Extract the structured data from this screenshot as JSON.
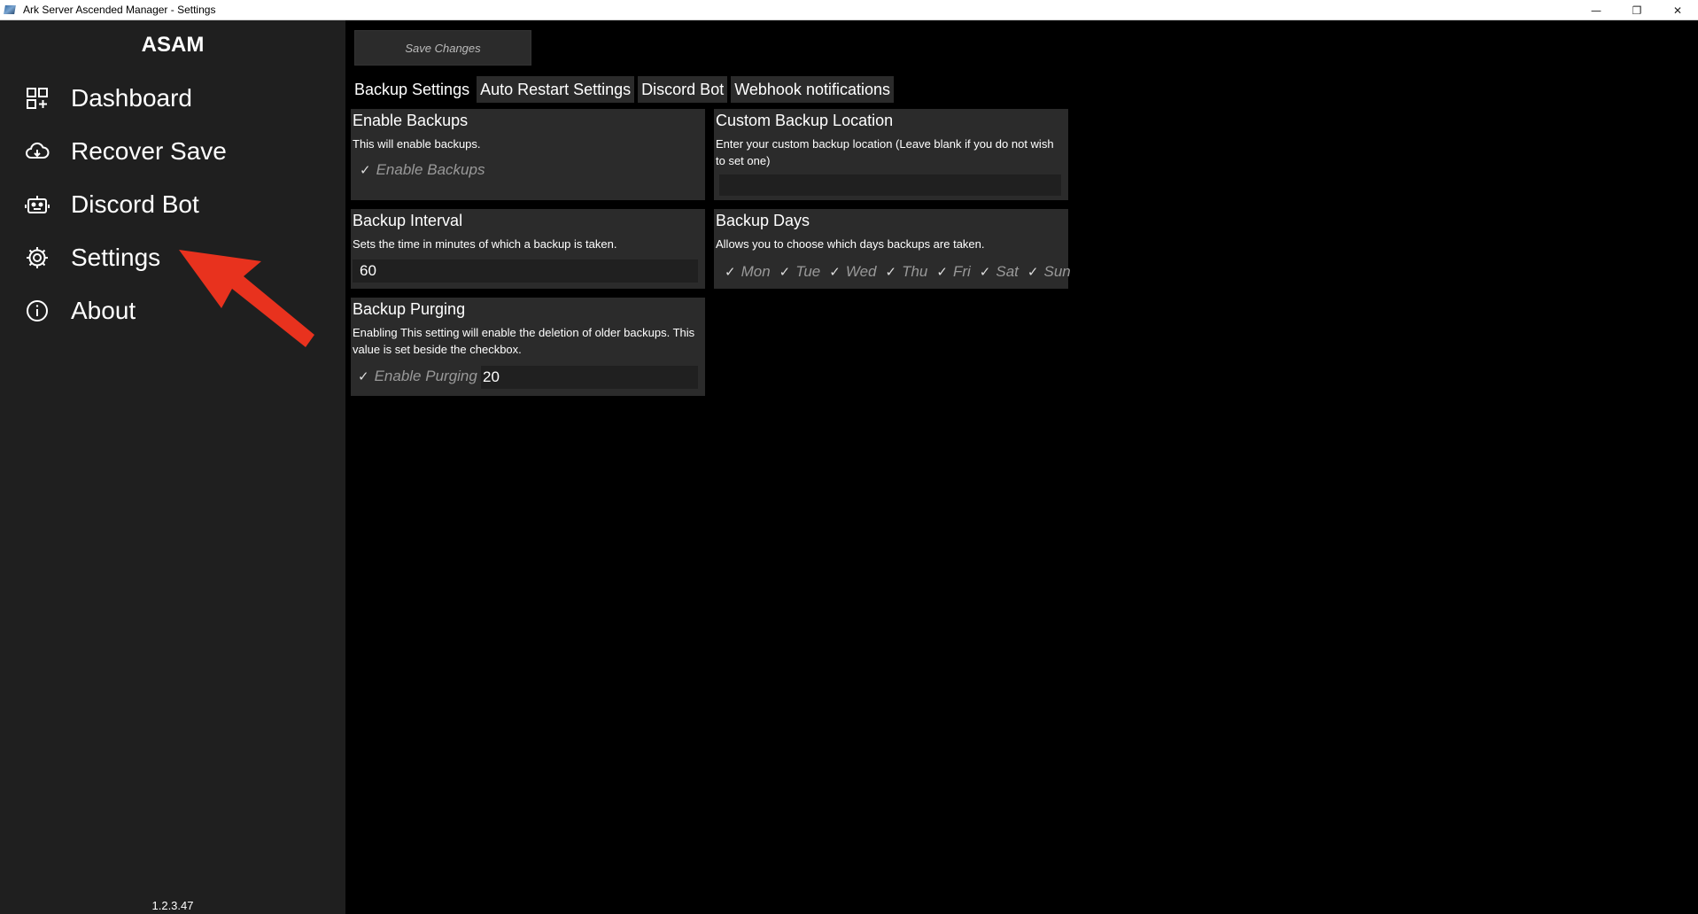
{
  "window": {
    "title": "Ark Server Ascended Manager - Settings",
    "minimize": "—",
    "restore": "❐",
    "close": "✕"
  },
  "sidebar": {
    "brand": "ASAM",
    "items": [
      {
        "label": "Dashboard",
        "icon": "dashboard-icon"
      },
      {
        "label": "Recover Save",
        "icon": "cloud-download-icon"
      },
      {
        "label": "Discord Bot",
        "icon": "bot-icon"
      },
      {
        "label": "Settings",
        "icon": "gear-icon"
      },
      {
        "label": "About",
        "icon": "info-icon"
      }
    ],
    "version": "1.2.3.47"
  },
  "toolbar": {
    "save_label": "Save Changes"
  },
  "tabs": [
    {
      "label": "Backup Settings",
      "active": true
    },
    {
      "label": "Auto Restart Settings",
      "active": false
    },
    {
      "label": "Discord Bot",
      "active": false
    },
    {
      "label": "Webhook notifications",
      "active": false
    }
  ],
  "cards": {
    "enable_backups": {
      "title": "Enable Backups",
      "desc": "This will enable backups.",
      "check_label": "Enable Backups",
      "checked": true
    },
    "custom_location": {
      "title": "Custom Backup Location",
      "desc": "Enter your custom backup location (Leave blank if you do not wish to set one)",
      "value": ""
    },
    "interval": {
      "title": "Backup Interval",
      "desc": "Sets the time in minutes of which a backup is taken.",
      "value": "60"
    },
    "days": {
      "title": "Backup Days",
      "desc": "Allows you to choose which days backups are taken.",
      "days": [
        "Mon",
        "Tue",
        "Wed",
        "Thu",
        "Fri",
        "Sat",
        "Sun"
      ]
    },
    "purging": {
      "title": "Backup Purging",
      "desc": "Enabling This setting will enable the deletion of older backups. This value is set beside the checkbox.",
      "check_label": "Enable Purging",
      "value": "20",
      "checked": true
    }
  },
  "colors": {
    "sidebar_bg": "#1f1f1f",
    "card_bg": "#2b2b2b",
    "annotation_arrow": "#e8321e"
  }
}
